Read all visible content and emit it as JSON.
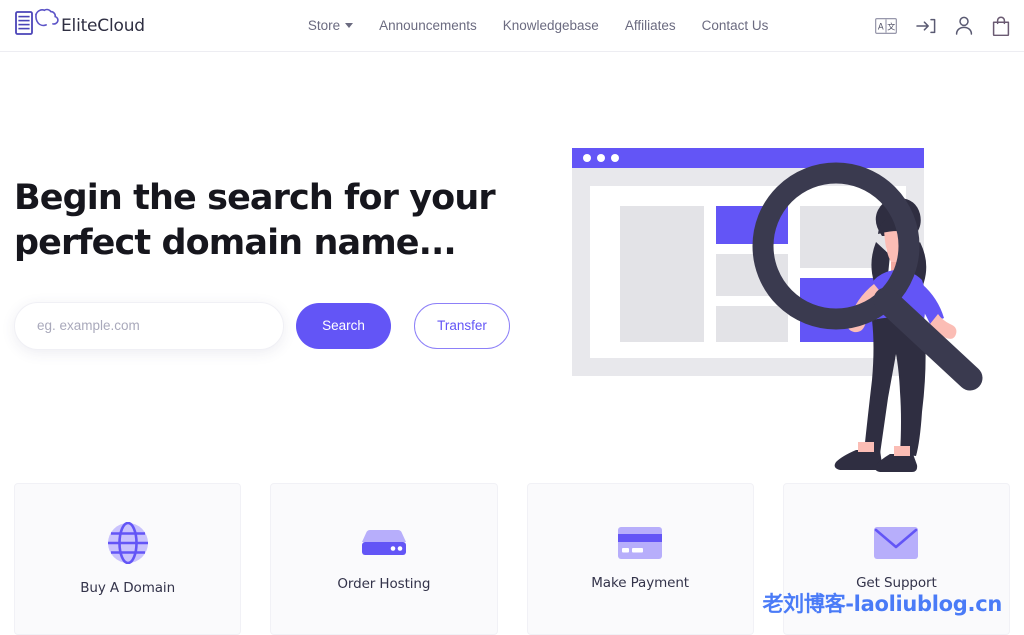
{
  "header": {
    "brand": {
      "name": "EliteCloud",
      "icon": "server-cloud-logo-icon"
    },
    "nav": [
      {
        "label": "Store",
        "icon": "chevron-down-icon",
        "has_dropdown": true
      },
      {
        "label": "Announcements",
        "has_dropdown": false
      },
      {
        "label": "Knowledgebase",
        "has_dropdown": false
      },
      {
        "label": "Affiliates",
        "has_dropdown": false
      },
      {
        "label": "Contact Us",
        "has_dropdown": false
      }
    ],
    "icons": [
      {
        "name": "language-selector-icon"
      },
      {
        "name": "login-icon"
      },
      {
        "name": "user-account-icon"
      },
      {
        "name": "shopping-bag-icon"
      }
    ]
  },
  "hero": {
    "title_line1": "Begin the search for your",
    "title_line2": "perfect domain name...",
    "search": {
      "placeholder": "eg. example.com",
      "value": "",
      "search_label": "Search",
      "transfer_label": "Transfer"
    },
    "illustration": "domain-search-browser-magnifier-person"
  },
  "cards": [
    {
      "label": "Buy A Domain",
      "icon": "globe-icon"
    },
    {
      "label": "Order Hosting",
      "icon": "server-icon"
    },
    {
      "label": "Make Payment",
      "icon": "credit-card-icon"
    },
    {
      "label": "Get Support",
      "icon": "envelope-icon"
    }
  ],
  "watermark": {
    "text": "老刘博客-laoliublog.cn"
  },
  "colors": {
    "accent": "#6355f6",
    "accent_light": "#a99ffb",
    "accent_pale": "#c9c2fd",
    "dark": "#3a3a4f",
    "skin": "#fbbdb5",
    "card_bg": "#fafafc",
    "watermark": "#4a7bf7"
  }
}
